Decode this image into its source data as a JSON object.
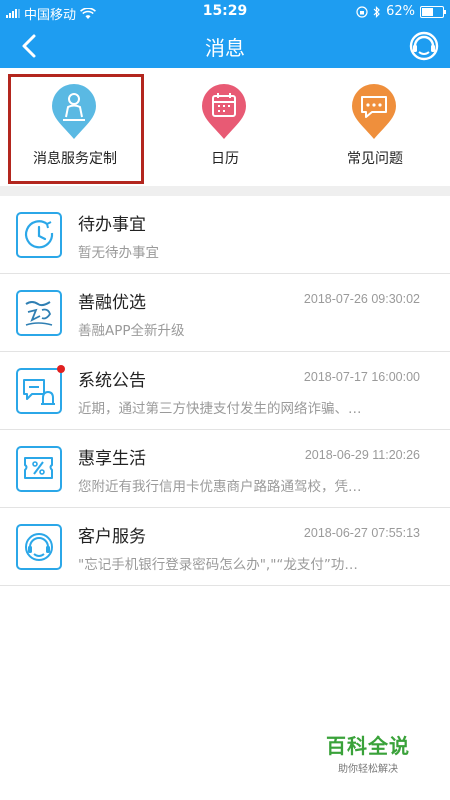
{
  "status_bar": {
    "carrier": "中国移动",
    "time": "15:29",
    "battery_text": "62%",
    "battery_level": 0.62
  },
  "nav": {
    "title": "消息",
    "back_icon": "chevron-left-icon",
    "support_icon": "headset-icon"
  },
  "quick_actions": [
    {
      "label": "消息服务定制",
      "icon": "person-pin-icon",
      "color": "#5ab9e3"
    },
    {
      "label": "日历",
      "icon": "calendar-pin-icon",
      "color": "#e85a74"
    },
    {
      "label": "常见问题",
      "icon": "chat-pin-icon",
      "color": "#ef8f3c"
    }
  ],
  "messages": [
    {
      "name": "待办事宜",
      "subtitle": "暂无待办事宜",
      "time": "",
      "icon": "clock-icon",
      "unread": false
    },
    {
      "name": "善融优选",
      "subtitle": "善融APP全新升级",
      "time": "2018-07-26 09:30:02",
      "icon": "shanrong-logo-icon",
      "unread": false
    },
    {
      "name": "系统公告",
      "subtitle": "近期，通过第三方快捷支付发生的网络诈骗、…",
      "time": "2018-07-17 16:00:00",
      "icon": "bell-bubble-icon",
      "unread": true
    },
    {
      "name": "惠享生活",
      "subtitle": "您附近有我行信用卡优惠商户路路通驾校，凭…",
      "time": "2018-06-29 11:20:26",
      "icon": "coupon-icon",
      "unread": false
    },
    {
      "name": "客户服务",
      "subtitle": "\"忘记手机银行登录密码怎么办\",\"“龙支付”功…",
      "time": "2018-06-27 07:55:13",
      "icon": "headset-icon",
      "unread": false
    }
  ],
  "watermark": {
    "title": "百科全说",
    "subtitle": "助你轻松解决"
  }
}
